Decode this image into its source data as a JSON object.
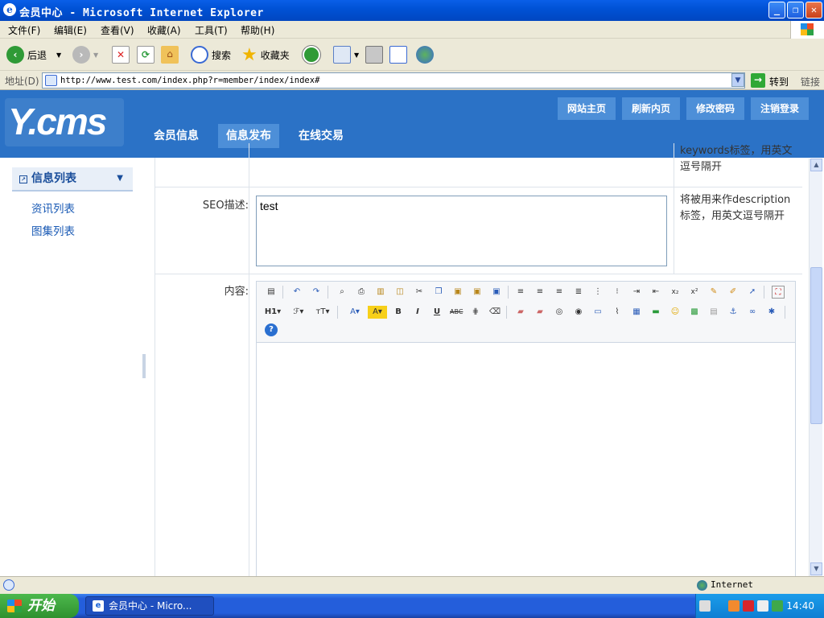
{
  "window": {
    "title": "会员中心 - Microsoft Internet Explorer"
  },
  "menubar": {
    "items": [
      "文件(F)",
      "编辑(E)",
      "查看(V)",
      "收藏(A)",
      "工具(T)",
      "帮助(H)"
    ]
  },
  "toolbar": {
    "back": "后退",
    "search": "搜索",
    "favorites": "收藏夹"
  },
  "address": {
    "label": "地址(D)",
    "url": "http://www.test.com/index.php?r=member/index/index#",
    "go": "转到",
    "links": "链接"
  },
  "site": {
    "logo": "Y.cms",
    "nav": [
      "会员信息",
      "信息发布",
      "在线交易"
    ],
    "active_nav": "信息发布",
    "header_buttons": [
      "网站主页",
      "刷新内页",
      "修改密码",
      "注销登录"
    ]
  },
  "sidebar": {
    "heading": "信息列表",
    "links": [
      "资讯列表",
      "图集列表"
    ]
  },
  "form": {
    "keywords_hint": "keywords标签，用英文逗号隔开",
    "seo_label": "SEO描述:",
    "seo_value": "test",
    "seo_hint": "将被用来作description标签，用英文逗号隔开",
    "content_label": "内容:"
  },
  "editor_toolbar": {
    "row1": [
      "source",
      "undo",
      "redo",
      "preview",
      "print",
      "template",
      "code",
      "cut",
      "copy",
      "paste",
      "paste-text",
      "paste-word",
      "align-left",
      "align-center",
      "align-right",
      "justify",
      "ordered-list",
      "unordered-list",
      "indent",
      "outdent",
      "subscript",
      "superscript",
      "clear-format",
      "select-all",
      "select",
      "fullscreen"
    ],
    "row2": [
      "H1",
      "font-family",
      "font-size",
      "font-color",
      "highlight",
      "B",
      "I",
      "U",
      "ABC",
      "line-height",
      "remove-format",
      "image",
      "multi-image",
      "flash",
      "media",
      "insert-table",
      "attachment",
      "table",
      "hr",
      "emoticon",
      "map",
      "page-break",
      "anchor",
      "link",
      "unlink"
    ],
    "row3": [
      "help"
    ]
  },
  "statusbar": {
    "zone": "Internet"
  },
  "taskbar": {
    "start": "开始",
    "task": "会员中心 - Micro...",
    "clock": "14:40"
  }
}
